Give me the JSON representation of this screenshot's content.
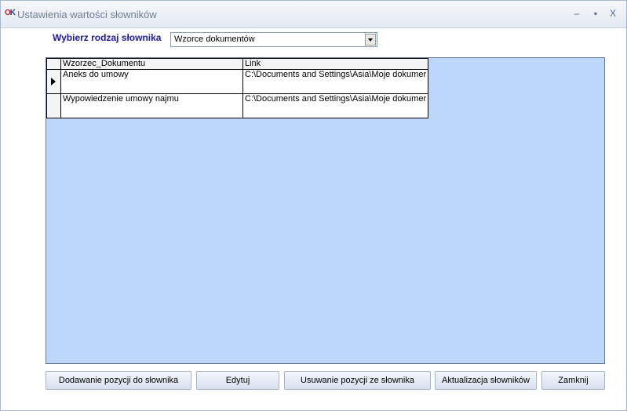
{
  "window": {
    "icon_text": "OK",
    "title": "Ustawienia wartości słowników",
    "minimize_glyph": "–",
    "maximize_glyph": "▪",
    "close_glyph": "X"
  },
  "selector": {
    "label": "Wybierz rodzaj słownika",
    "selected": "Wzorce dokumentów"
  },
  "grid": {
    "columns": [
      "Wzorzec_Dokumentu",
      "Link"
    ],
    "rows": [
      {
        "current": true,
        "cells": [
          "Aneks do umowy",
          "C:\\Documents and Settings\\Asia\\Moje dokumer"
        ]
      },
      {
        "current": false,
        "cells": [
          "Wypowiedzenie umowy najmu",
          "C:\\Documents and Settings\\Asia\\Moje dokumer"
        ]
      }
    ]
  },
  "buttons": {
    "add": "Dodawanie pozycji do słownika",
    "edit": "Edytuj",
    "remove": "Usuwanie pozycji ze słownika",
    "refresh": "Aktualizacja słowników",
    "close": "Zamknij"
  },
  "colors": {
    "grid_background": "#bdd7fb",
    "label_color": "#1a1aa8"
  }
}
